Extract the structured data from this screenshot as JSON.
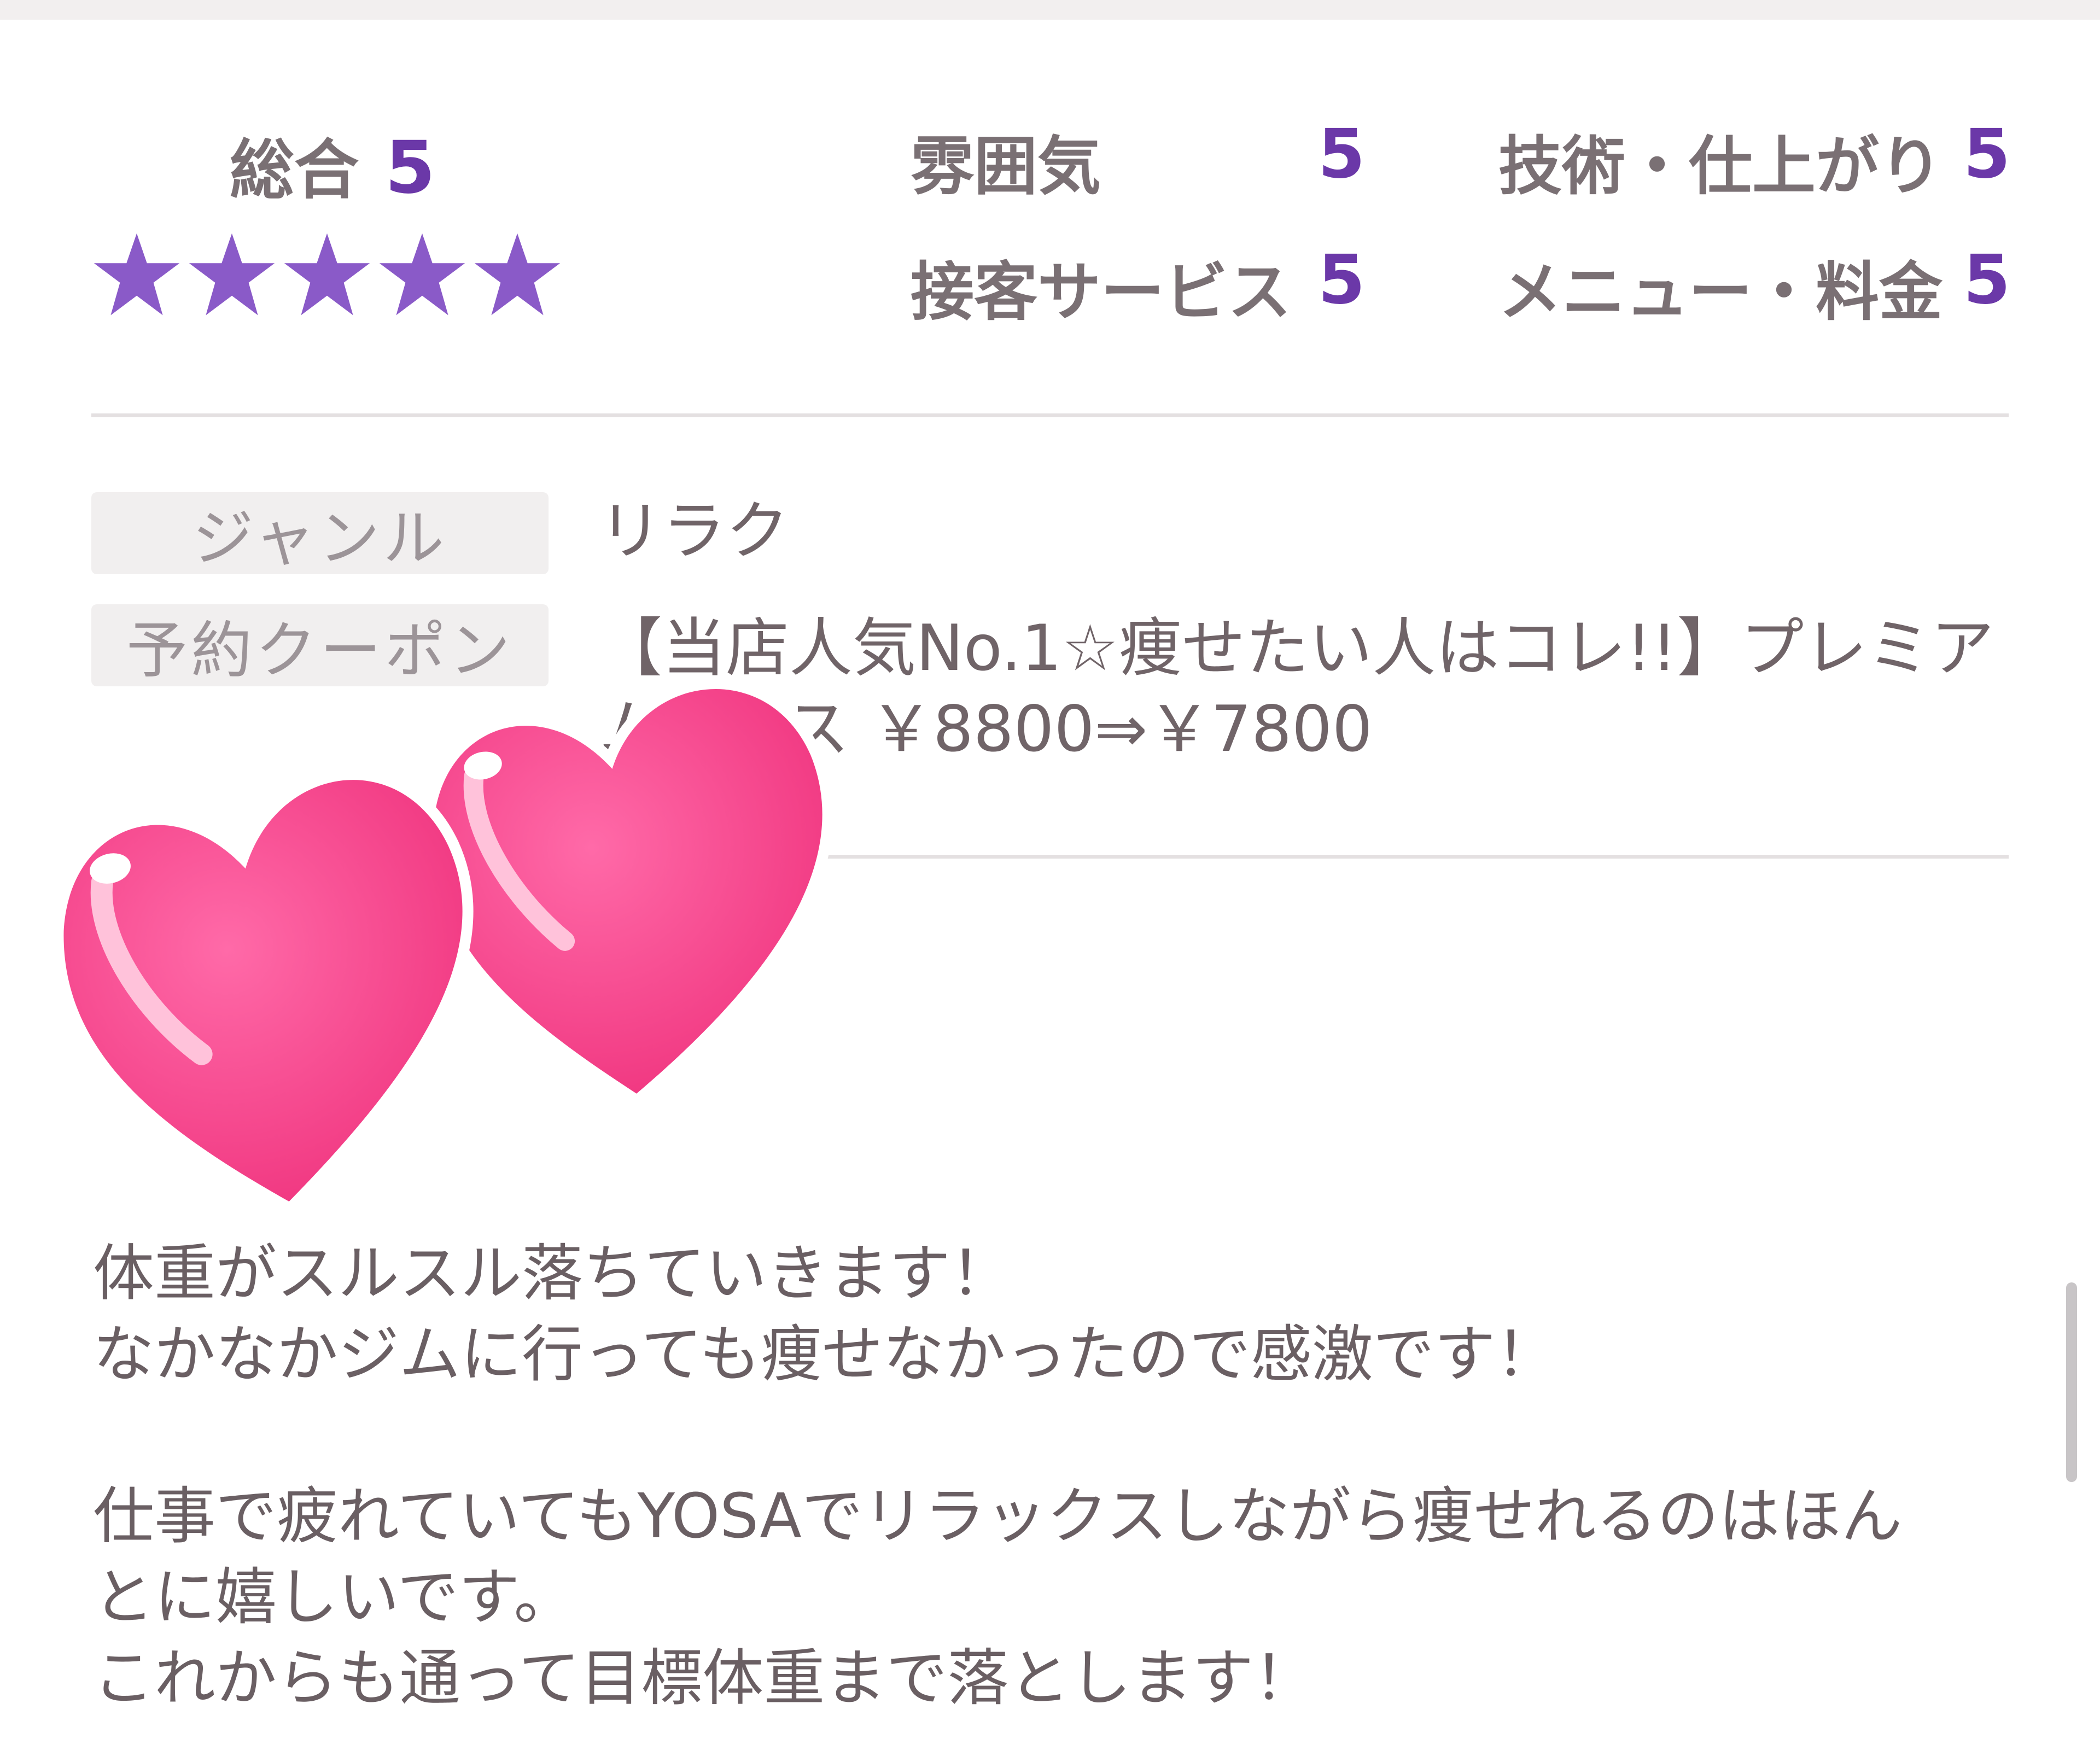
{
  "rating": {
    "overall_label": "総合",
    "overall_value": "5",
    "stars": 5,
    "accent_color": "#6b38a8",
    "star_color": "#8a5ac8",
    "categories": [
      {
        "label": "雰囲気",
        "value": "5"
      },
      {
        "label": "接客サービス",
        "value": "5"
      },
      {
        "label": "技術・仕上がり",
        "value": "5"
      },
      {
        "label": "メニュー・料金",
        "value": "5"
      }
    ]
  },
  "info": {
    "genre_label": "ジャンル",
    "genre_value": "リラク",
    "coupon_label": "予約クーポン",
    "coupon_line1": "【当店人気No.1☆痩せたい人はコレ!!】プレミア",
    "coupon_line2": "ムコース ￥8800⇒￥7800"
  },
  "decoration": {
    "icon": "pink-hearts",
    "heart_color": "#ff4d94"
  },
  "review": {
    "lines": [
      "体重がスルスル落ちていきます！",
      "なかなかジムに行っても痩せなかったので感激です！",
      "",
      "仕事で疲れていてもYOSAでリラックスしながら痩せれるのはほん",
      "とに嬉しいです。",
      "これからも通って目標体重まで落とします！"
    ]
  }
}
